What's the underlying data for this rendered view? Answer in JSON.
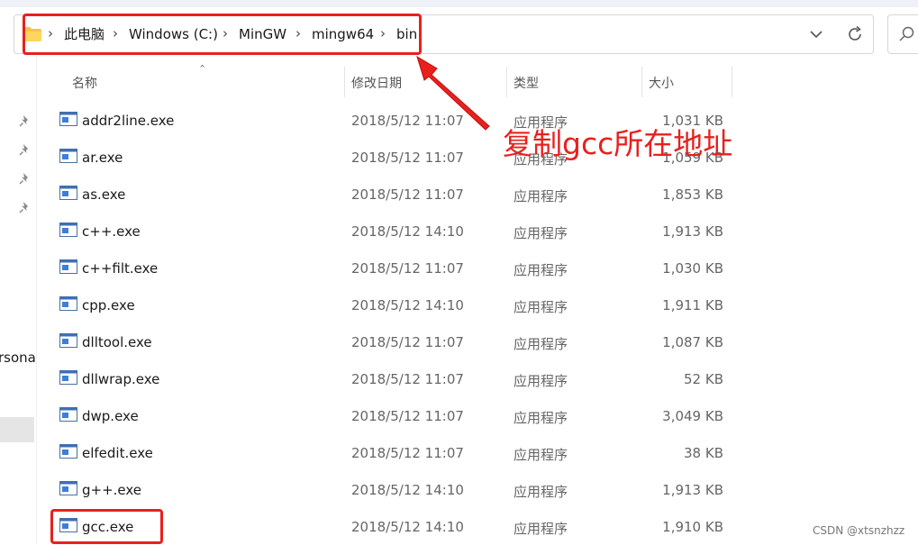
{
  "breadcrumb": {
    "items": [
      "此电脑",
      "Windows (C:)",
      "MinGW",
      "mingw64",
      "bin"
    ],
    "separator": "›"
  },
  "left_panel": {
    "partial_label": "rsona"
  },
  "columns": {
    "name": "名称",
    "modified": "修改日期",
    "type": "类型",
    "size": "大小"
  },
  "files": [
    {
      "name": "addr2line.exe",
      "date": "2018/5/12 11:07",
      "type": "应用程序",
      "size": "1,031 KB"
    },
    {
      "name": "ar.exe",
      "date": "2018/5/12 11:07",
      "type": "应用程序",
      "size": "1,059 KB"
    },
    {
      "name": "as.exe",
      "date": "2018/5/12 11:07",
      "type": "应用程序",
      "size": "1,853 KB"
    },
    {
      "name": "c++.exe",
      "date": "2018/5/12 14:10",
      "type": "应用程序",
      "size": "1,913 KB"
    },
    {
      "name": "c++filt.exe",
      "date": "2018/5/12 11:07",
      "type": "应用程序",
      "size": "1,030 KB"
    },
    {
      "name": "cpp.exe",
      "date": "2018/5/12 14:10",
      "type": "应用程序",
      "size": "1,911 KB"
    },
    {
      "name": "dlltool.exe",
      "date": "2018/5/12 11:07",
      "type": "应用程序",
      "size": "1,087 KB"
    },
    {
      "name": "dllwrap.exe",
      "date": "2018/5/12 11:07",
      "type": "应用程序",
      "size": "52 KB"
    },
    {
      "name": "dwp.exe",
      "date": "2018/5/12 11:07",
      "type": "应用程序",
      "size": "3,049 KB"
    },
    {
      "name": "elfedit.exe",
      "date": "2018/5/12 11:07",
      "type": "应用程序",
      "size": "38 KB"
    },
    {
      "name": "g++.exe",
      "date": "2018/5/12 14:10",
      "type": "应用程序",
      "size": "1,913 KB"
    },
    {
      "name": "gcc.exe",
      "date": "2018/5/12 14:10",
      "type": "应用程序",
      "size": "1,910 KB"
    }
  ],
  "annotation": {
    "text": "复制gcc所在地址",
    "color": "#e8201e"
  },
  "watermark": "CSDN @xtsnzhzz",
  "icons": {
    "folder": "folder-icon",
    "chevron": "chevron-down-icon",
    "refresh": "refresh-icon",
    "search": "search-icon",
    "pin": "pin-icon",
    "file": "exe-file-icon"
  }
}
